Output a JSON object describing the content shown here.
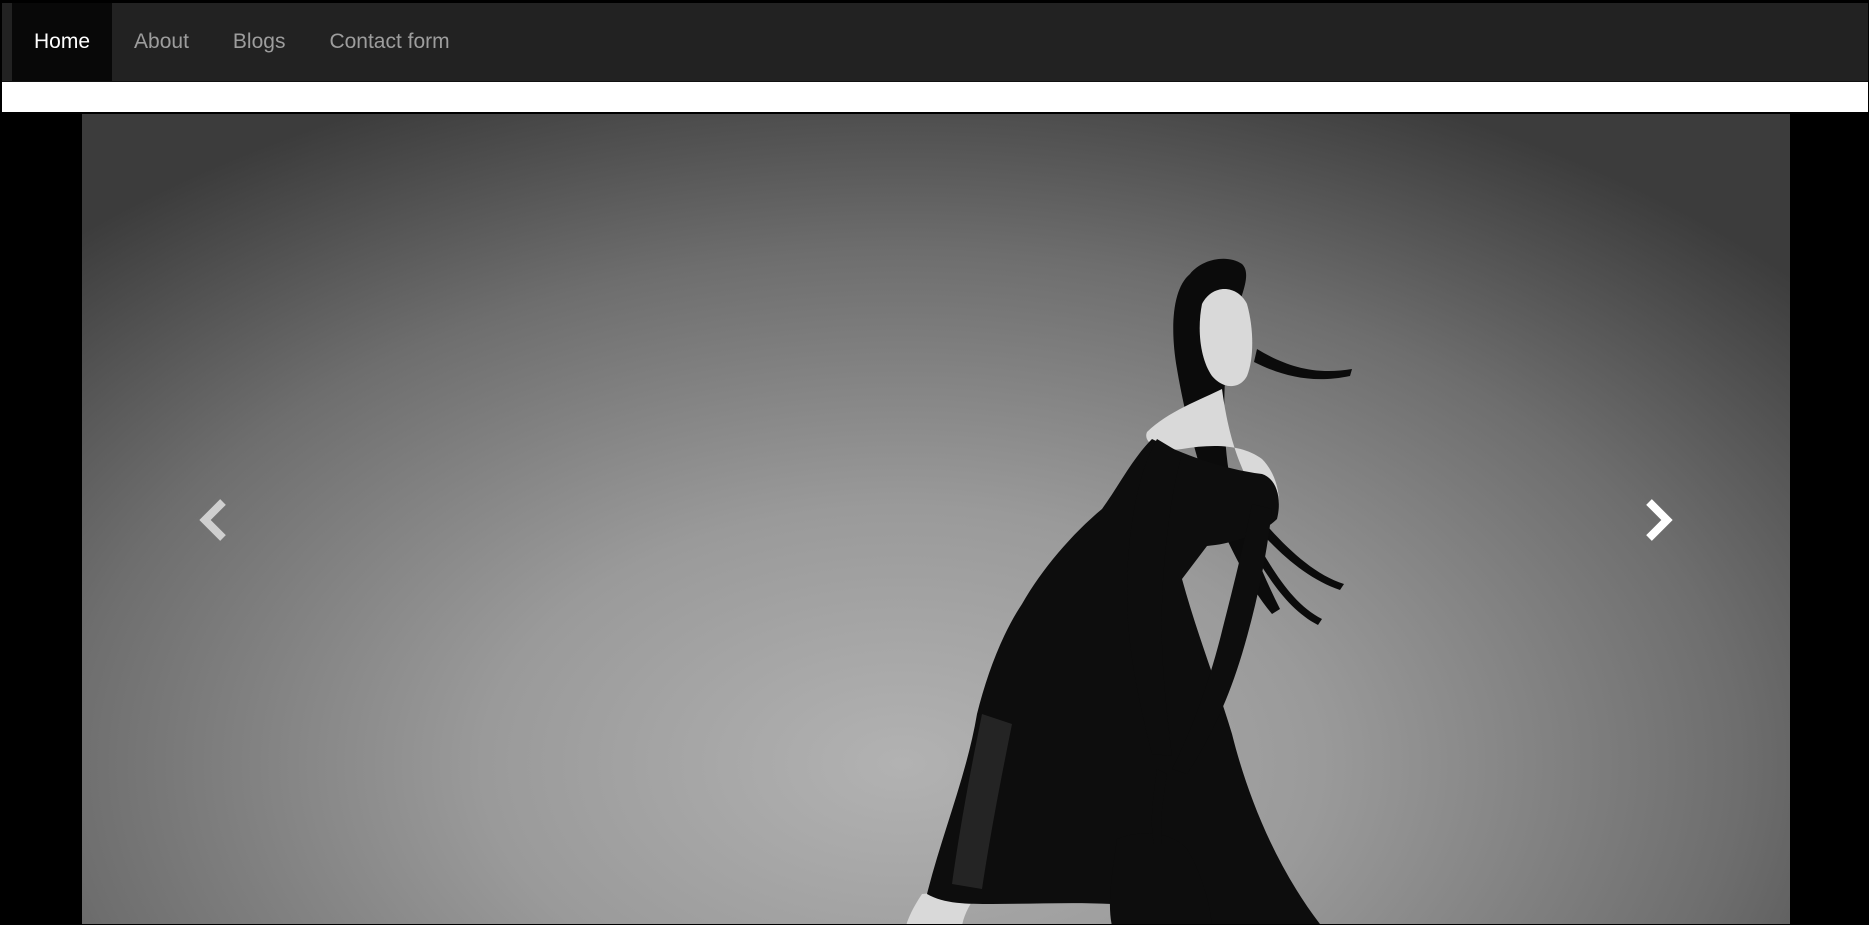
{
  "nav": {
    "items": [
      {
        "label": "Home",
        "active": true
      },
      {
        "label": "About",
        "active": false
      },
      {
        "label": "Blogs",
        "active": false
      },
      {
        "label": "Contact form",
        "active": false
      }
    ]
  },
  "carousel": {
    "image_alt": "Black and white fashion photo of a woman in a black dress holding a bag",
    "prev_icon": "chevron-left-icon",
    "next_icon": "chevron-right-icon"
  },
  "colors": {
    "navbar_bg": "#222222",
    "nav_active_bg": "#080808",
    "nav_text": "#9d9d9d",
    "nav_active_text": "#ffffff",
    "page_bg": "#000000"
  }
}
